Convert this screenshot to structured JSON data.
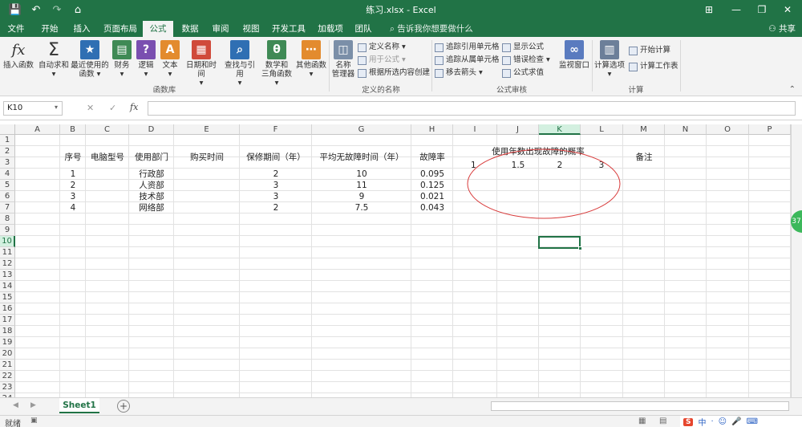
{
  "window": {
    "title": "练习.xlsx  -  Excel",
    "minimize": "—",
    "restore": "❐",
    "close": "✕",
    "ribbon_toggle": "⊞",
    "colors": {
      "brand": "#217346",
      "accent_light": "#d3f0e0"
    }
  },
  "quick_access": {
    "save_icon": "💾",
    "undo_icon": "↶",
    "redo_icon": "↷",
    "custom_icon": "⌂"
  },
  "menu": {
    "tabs": [
      "文件",
      "开始",
      "插入",
      "页面布局",
      "公式",
      "数据",
      "审阅",
      "视图",
      "开发工具",
      "加载项",
      "团队"
    ],
    "active": "公式",
    "search_placeholder": "告诉我你想要做什么",
    "share": "共享"
  },
  "ribbon": {
    "function_library": {
      "insert_function": "插入函数",
      "autosum": [
        "自动求和",
        "▾"
      ],
      "recent": [
        "最近使用的",
        "函数 ▾"
      ],
      "financial": [
        "财务",
        "▾"
      ],
      "logical": [
        "逻辑",
        "▾"
      ],
      "text": [
        "文本",
        "▾"
      ],
      "datetime": [
        "日期和时间",
        "▾"
      ],
      "lookup": [
        "查找与引用",
        "▾"
      ],
      "math": [
        "数学和",
        "三角函数 ▾"
      ],
      "more": [
        "其他函数",
        "▾"
      ],
      "group_label": "函数库"
    },
    "defined_names": {
      "name_manager": [
        "名称",
        "管理器"
      ],
      "define_name": "定义名称 ▾",
      "use_in_formula": "用于公式 ▾",
      "create_from_selection": "根据所选内容创建",
      "group_label": "定义的名称"
    },
    "formula_auditing": {
      "trace_precedents": "追踪引用单元格",
      "trace_dependents": "追踪从属单元格",
      "remove_arrows": "移去箭头 ▾",
      "show_formulas": "显示公式",
      "error_checking": "错误检查 ▾",
      "evaluate_formula": "公式求值",
      "watch_window": "监视窗口",
      "group_label": "公式审核"
    },
    "calculation": {
      "calc_options": [
        "计算选项",
        "▾"
      ],
      "calc_now": "开始计算",
      "calc_sheet": "计算工作表",
      "group_label": "计算"
    }
  },
  "formula_bar": {
    "name_box": "K10",
    "cancel": "✕",
    "enter": "✓",
    "fx": "fx",
    "value": ""
  },
  "sheet": {
    "columns": [
      "A",
      "B",
      "C",
      "D",
      "E",
      "F",
      "G",
      "H",
      "I",
      "J",
      "K",
      "L",
      "M",
      "N",
      "O",
      "P"
    ],
    "rows": [
      "1",
      "2",
      "3",
      "4",
      "5",
      "6",
      "7",
      "8",
      "9",
      "10",
      "11",
      "12",
      "13",
      "14",
      "15",
      "16",
      "17",
      "18",
      "19",
      "20",
      "21",
      "22",
      "23",
      "24"
    ],
    "selected_cell": "K10",
    "headers": {
      "seq": "序号",
      "model": "电脑型号",
      "dept": "使用部门",
      "buy_time": "购买时间",
      "warranty": "保修期间（年）",
      "mtbf": "平均无故障时间（年）",
      "fail_rate": "故障率",
      "prob_title": "使用年数出现故障的概率",
      "note": "备注"
    },
    "prob_years": [
      "1",
      "1.5",
      "2",
      "3"
    ],
    "data_rows": [
      {
        "seq": "1",
        "dept": "行政部",
        "warranty": "2",
        "mtbf": "10",
        "rate": "0.095"
      },
      {
        "seq": "2",
        "dept": "人资部",
        "warranty": "3",
        "mtbf": "11",
        "rate": "0.125"
      },
      {
        "seq": "3",
        "dept": "技术部",
        "warranty": "3",
        "mtbf": "9",
        "rate": "0.021"
      },
      {
        "seq": "4",
        "dept": "网络部",
        "warranty": "2",
        "mtbf": "7.5",
        "rate": "0.043"
      }
    ],
    "annotation_color": "#d83b3b"
  },
  "tabs_bar": {
    "sheet_tab": "Sheet1",
    "add": "+",
    "prev": "◀",
    "next": "▶"
  },
  "status": {
    "ready": "就绪",
    "zoom_badge": "37",
    "ime": [
      "S",
      "中",
      "·",
      "☺",
      "🎤",
      "⌨"
    ]
  }
}
